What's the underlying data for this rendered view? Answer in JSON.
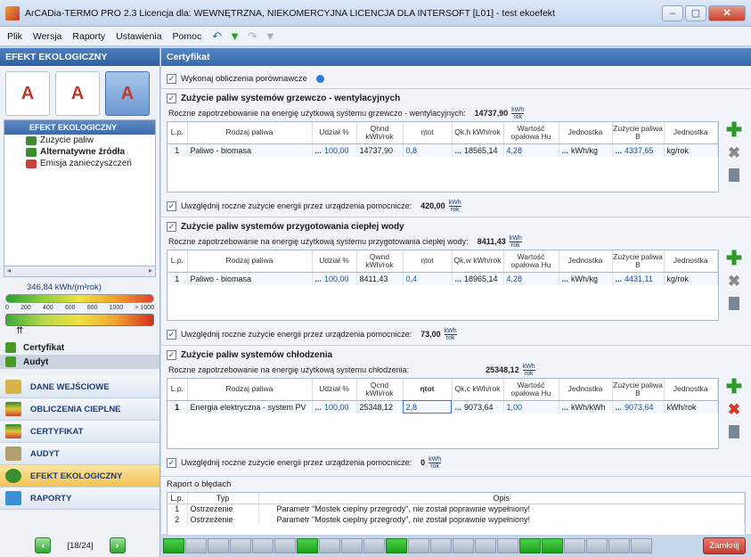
{
  "window": {
    "title": "ArCADia-TERMO PRO 2.3 Licencja dla: WEWNĘTRZNA, NIEKOMERCYJNA LICENCJA DLA INTERSOFT [L01] - test ekoefekt"
  },
  "menu": {
    "items": [
      "Plik",
      "Wersja",
      "Raporty",
      "Ustawienia",
      "Pomoc"
    ]
  },
  "sidebar": {
    "header": "EFEKT EKOLOGICZNY",
    "tree_header": "EFEKT EKOLOGICZNY",
    "tree_items": [
      "Zużycie paliw",
      "Alternatywne źródła",
      "Emisja zanieczyszczeń"
    ],
    "gauge_value": "346,84 kWh/(m²rok)",
    "gauge_ticks": [
      "0",
      "200",
      "400",
      "600",
      "800",
      "1000",
      "> 1000"
    ],
    "subnav": [
      "Certyfikat",
      "Audyt"
    ],
    "nav": [
      "DANE WEJŚCIOWE",
      "OBLICZENIA CIEPLNE",
      "CERTYFIKAT",
      "AUDYT",
      "EFEKT EKOLOGICZNY",
      "RAPORTY"
    ],
    "page_indicator": "[18/24]"
  },
  "main": {
    "header": "Certyfikat",
    "comparative_label": "Wykonaj obliczenia porównawcze",
    "unit_num": "kWh",
    "unit_den": "rok",
    "aux_label": "Uwzględnij roczne zużycie energii przez urządzenia pomocnicze:",
    "heating": {
      "title": "Zużycie paliw systemów grzewczo - wentylacyjnych",
      "demand_label": "Roczne zapotrzebowanie na energię użytkową systemu grzewczo - wentylacyjnych:",
      "demand_value": "14737,90",
      "headers": [
        "L.p.",
        "Rodzaj paliwa",
        "Udział %",
        "Qhnd kWh/rok",
        "ηtot",
        "Qk,h kWh/rok",
        "Wartość opałowa Hu",
        "Jednostka",
        "Zużycie paliwa B",
        "Jednostka"
      ],
      "row": [
        "1",
        "Paliwo - biomasa",
        "100,00",
        "14737,90",
        "0,8",
        "18565,14",
        "4,28",
        "kWh/kg",
        "4337,65",
        "kg/rok"
      ],
      "aux_value": "420,00"
    },
    "water": {
      "title": "Zużycie paliw systemów przygotowania ciepłej wody",
      "demand_label": "Roczne zapotrzebowanie na energię użytkową systemu przygotowania ciepłej wody:",
      "demand_value": "8411,43",
      "headers": [
        "L.p.",
        "Rodzaj paliwa",
        "Udział %",
        "Qwnd kWh/rok",
        "ηtot",
        "Qk,w kWh/rok",
        "Wartość opałowa Hu",
        "Jednostka",
        "Zużycie paliwa B",
        "Jednostka"
      ],
      "row": [
        "1",
        "Paliwo - biomasa",
        "100,00",
        "8411,43",
        "0,4",
        "18965,14",
        "4,28",
        "kWh/kg",
        "4431,11",
        "kg/rok"
      ],
      "aux_value": "73,00"
    },
    "cooling": {
      "title": "Zużycie paliw systemów chłodzenia",
      "demand_label": "Roczne zapotrzebowanie na energię użytkową systemu chłodzenia:",
      "demand_value": "25348,12",
      "headers": [
        "L.p.",
        "Rodzaj paliwa",
        "Udział %",
        "Qcnd kWh/rok",
        "ηtot",
        "Qk,c kWh/rok",
        "Wartość opałowa Hu",
        "Jednostka",
        "Zużycie paliwa B",
        "Jednostka"
      ],
      "row": [
        "1",
        "Energia elektryczna - system PV",
        "100,00",
        "25348,12",
        "2,8",
        "9073,64",
        "1,00",
        "kWh/kWh",
        "9073,64",
        "kWh/rok"
      ],
      "aux_value": "0"
    },
    "report": {
      "title": "Raport o błędach",
      "headers": [
        "L.p.",
        "Typ",
        "Opis"
      ],
      "rows": [
        [
          "1",
          "Ostrzeżenie",
          "Parametr \"Mostek cieplny przegrody\", nie został poprawnie wypełniony!"
        ],
        [
          "2",
          "Ostrzeżenie",
          "Parametr \"Mostek cieplny przegrody\", nie został poprawnie wypełniony!"
        ]
      ]
    }
  },
  "statusbar": {
    "close_label": "Zamknij"
  }
}
